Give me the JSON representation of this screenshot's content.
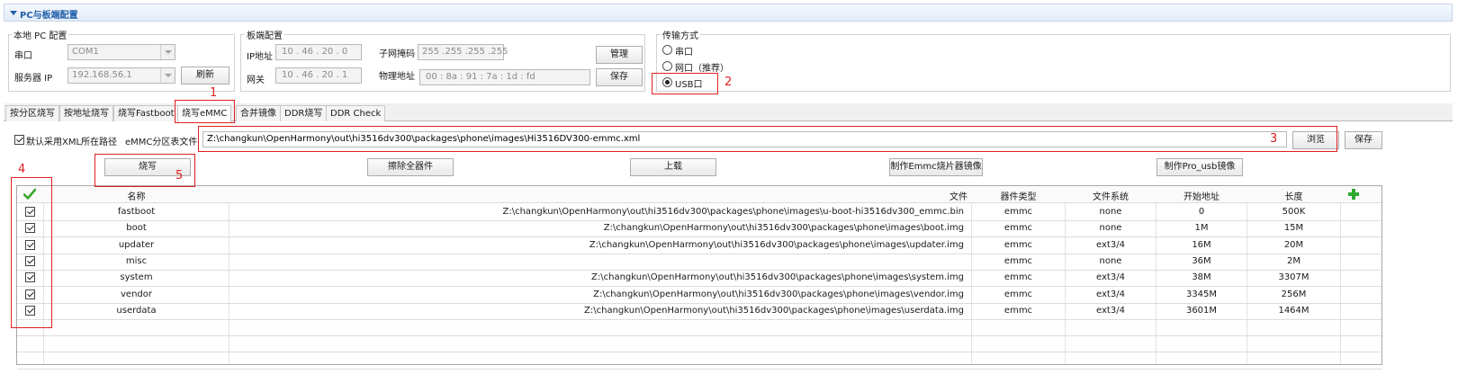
{
  "section": {
    "title": "PC与板端配置"
  },
  "local_pc": {
    "group_label": "本地 PC 配置",
    "serial_label": "串口",
    "serial_value": "COM1",
    "server_ip_label": "服务器 IP",
    "server_ip_value": "192.168.56.1",
    "refresh_button": "刷新"
  },
  "board": {
    "group_label": "板端配置",
    "ip_label": "IP地址",
    "ip_value": [
      "10",
      "46",
      "20",
      "0"
    ],
    "subnet_label": "子网掩码",
    "subnet_value": [
      "255",
      "255",
      "255",
      "255"
    ],
    "gateway_label": "网关",
    "gateway_value": [
      "10",
      "46",
      "20",
      "1"
    ],
    "mac_label": "物理地址",
    "mac_value": [
      "00",
      "8a",
      "91",
      "7a",
      "1d",
      "fd"
    ],
    "manage_button": "管理",
    "save_button": "保存"
  },
  "transfer": {
    "group_label": "传输方式",
    "options": [
      "串口",
      "网口（推荐）",
      "USB口"
    ],
    "selected": "USB口"
  },
  "tabs": [
    "按分区烧写",
    "按地址烧写",
    "烧写Fastboot",
    "烧写eMMC",
    "合并镜像",
    "DDR烧写",
    "DDR Check"
  ],
  "active_tab": "烧写eMMC",
  "emmc": {
    "default_xml_label": "默认采用XML所在路径",
    "table_file_label": "eMMC分区表文件",
    "table_file_value": "Z:\\changkun\\OpenHarmony\\out\\hi3516dv300\\packages\\phone\\images\\Hi3516DV300-emmc.xml",
    "browse_button": "浏览",
    "save_button": "保存"
  },
  "actions": {
    "burn": "烧写",
    "erase_all": "擦除全器件",
    "upload": "上载",
    "make_emmc_image": "制作Emmc烧片器镜像",
    "make_pro_usb_image": "制作Pro_usb镜像"
  },
  "table": {
    "columns": [
      "名称",
      "文件",
      "器件类型",
      "文件系统",
      "开始地址",
      "长度"
    ],
    "rows": [
      {
        "checked": true,
        "name": "fastboot",
        "file": "Z:\\changkun\\OpenHarmony\\out\\hi3516dv300\\packages\\phone\\images\\u-boot-hi3516dv300_emmc.bin",
        "device": "emmc",
        "fs": "none",
        "start": "0",
        "length": "500K"
      },
      {
        "checked": true,
        "name": "boot",
        "file": "Z:\\changkun\\OpenHarmony\\out\\hi3516dv300\\packages\\phone\\images\\boot.img",
        "device": "emmc",
        "fs": "none",
        "start": "1M",
        "length": "15M"
      },
      {
        "checked": true,
        "name": "updater",
        "file": "Z:\\changkun\\OpenHarmony\\out\\hi3516dv300\\packages\\phone\\images\\updater.img",
        "device": "emmc",
        "fs": "ext3/4",
        "start": "16M",
        "length": "20M"
      },
      {
        "checked": true,
        "name": "misc",
        "file": "",
        "device": "emmc",
        "fs": "none",
        "start": "36M",
        "length": "2M"
      },
      {
        "checked": true,
        "name": "system",
        "file": "Z:\\changkun\\OpenHarmony\\out\\hi3516dv300\\packages\\phone\\images\\system.img",
        "device": "emmc",
        "fs": "ext3/4",
        "start": "38M",
        "length": "3307M"
      },
      {
        "checked": true,
        "name": "vendor",
        "file": "Z:\\changkun\\OpenHarmony\\out\\hi3516dv300\\packages\\phone\\images\\vendor.img",
        "device": "emmc",
        "fs": "ext3/4",
        "start": "3345M",
        "length": "256M"
      },
      {
        "checked": true,
        "name": "userdata",
        "file": "Z:\\changkun\\OpenHarmony\\out\\hi3516dv300\\packages\\phone\\images\\userdata.img",
        "device": "emmc",
        "fs": "ext3/4",
        "start": "3601M",
        "length": "1464M"
      }
    ]
  },
  "annotations": [
    "1",
    "2",
    "3",
    "4",
    "5"
  ],
  "colors": {
    "annotation": "#e02020",
    "header_text": "#1f5fa8",
    "check_green": "#3aa82e",
    "add_green": "#2ea82e"
  },
  "icons": {
    "select_all": "check-icon",
    "add_row": "plus-icon"
  }
}
